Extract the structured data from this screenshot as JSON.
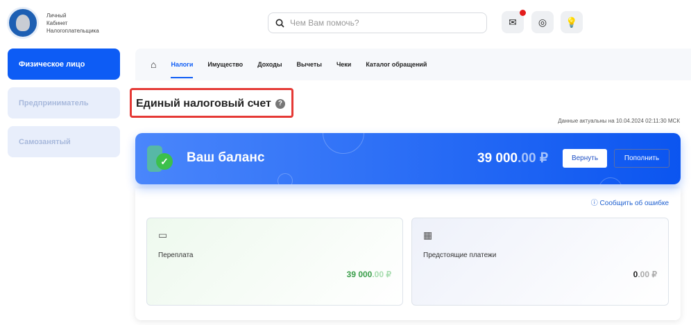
{
  "header": {
    "logo_lines": [
      "Личный",
      "Кабинет",
      "Налогоплательщика"
    ],
    "search_placeholder": "Чем Вам помочь?"
  },
  "sidebar": [
    {
      "label": "Физическое лицо",
      "active": true
    },
    {
      "label": "Предприниматель"
    },
    {
      "label": "Самозанятый"
    }
  ],
  "nav": [
    "Налоги",
    "Имущество",
    "Доходы",
    "Вычеты",
    "Чеки",
    "Каталог обращений"
  ],
  "page_title": "Единый налоговый счет",
  "help": "?",
  "date_note": "Данные актуальны на 10.04.2024 02:11:30 МСК",
  "balance": {
    "title": "Ваш баланс",
    "amount_int": "39 000",
    "amount_dec": ".00 ₽",
    "return_label": "Вернуть",
    "topup_label": "Пополнить"
  },
  "report_label": "Сообщить об ошибке",
  "panels": [
    {
      "label": "Переплата",
      "amount_int": "39 000",
      "amount_dec": ".00 ₽",
      "color": "#3a9e4a"
    },
    {
      "label": "Предстоящие платежи",
      "amount_int": "0",
      "amount_dec": ".00 ₽",
      "color": "#333"
    }
  ]
}
